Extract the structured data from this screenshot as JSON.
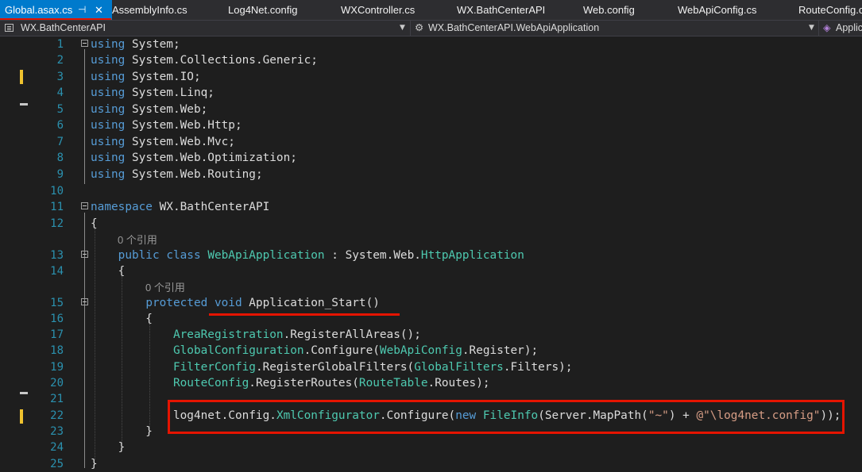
{
  "tabs": [
    {
      "label": "Global.asax.cs",
      "active": true,
      "pin_glyph": "⊣",
      "close_glyph": "✕"
    },
    {
      "label": "AssemblyInfo.cs"
    },
    {
      "label": "Log4Net.config"
    },
    {
      "label": "WXController.cs"
    },
    {
      "label": "WX.BathCenterAPI"
    },
    {
      "label": "Web.config"
    },
    {
      "label": "WebApiConfig.cs"
    },
    {
      "label": "RouteConfig.c"
    }
  ],
  "navbar": {
    "project": "WX.BathCenterAPI",
    "type_scope": "WX.BathCenterAPI.WebApiApplication",
    "member_scope": "Applic"
  },
  "codelens": {
    "class_refs": "0 个引用",
    "method_refs": "0 个引用"
  },
  "lines": [
    {
      "n": "1",
      "tokens": [
        {
          "t": "using",
          "c": "kw"
        },
        {
          "t": " System;",
          "c": "pl"
        }
      ]
    },
    {
      "n": "2",
      "tokens": [
        {
          "t": "using",
          "c": "kw"
        },
        {
          "t": " System.Collections.Generic;",
          "c": "pl"
        }
      ]
    },
    {
      "n": "3",
      "tokens": [
        {
          "t": "using",
          "c": "kw"
        },
        {
          "t": " System.IO;",
          "c": "pl"
        }
      ]
    },
    {
      "n": "4",
      "tokens": [
        {
          "t": "using",
          "c": "kw"
        },
        {
          "t": " System.Linq;",
          "c": "pl"
        }
      ]
    },
    {
      "n": "5",
      "tokens": [
        {
          "t": "using",
          "c": "kw"
        },
        {
          "t": " System.Web;",
          "c": "pl"
        }
      ]
    },
    {
      "n": "6",
      "tokens": [
        {
          "t": "using",
          "c": "kw"
        },
        {
          "t": " System.Web.Http;",
          "c": "pl"
        }
      ]
    },
    {
      "n": "7",
      "tokens": [
        {
          "t": "using",
          "c": "kw"
        },
        {
          "t": " System.Web.Mvc;",
          "c": "pl"
        }
      ]
    },
    {
      "n": "8",
      "tokens": [
        {
          "t": "using",
          "c": "kw"
        },
        {
          "t": " System.Web.Optimization;",
          "c": "pl"
        }
      ]
    },
    {
      "n": "9",
      "tokens": [
        {
          "t": "using",
          "c": "kw"
        },
        {
          "t": " System.Web.Routing;",
          "c": "pl"
        }
      ]
    },
    {
      "n": "10",
      "tokens": []
    },
    {
      "n": "11",
      "tokens": [
        {
          "t": "namespace",
          "c": "kw"
        },
        {
          "t": " WX.BathCenterAPI",
          "c": "pl"
        }
      ]
    },
    {
      "n": "12",
      "tokens": [
        {
          "t": "{",
          "c": "pl"
        }
      ]
    },
    {
      "n": "13",
      "tokens": [
        {
          "t": "    ",
          "c": "pl"
        },
        {
          "t": "public",
          "c": "kw"
        },
        {
          "t": " ",
          "c": "pl"
        },
        {
          "t": "class",
          "c": "kw"
        },
        {
          "t": " ",
          "c": "pl"
        },
        {
          "t": "WebApiApplication",
          "c": "ty"
        },
        {
          "t": " : System.Web.",
          "c": "pl"
        },
        {
          "t": "HttpApplication",
          "c": "ty"
        }
      ]
    },
    {
      "n": "14",
      "tokens": [
        {
          "t": "    {",
          "c": "pl"
        }
      ]
    },
    {
      "n": "15",
      "tokens": [
        {
          "t": "        ",
          "c": "pl"
        },
        {
          "t": "protected",
          "c": "kw"
        },
        {
          "t": " ",
          "c": "pl"
        },
        {
          "t": "void",
          "c": "kw"
        },
        {
          "t": " Application_Start()",
          "c": "pl"
        }
      ]
    },
    {
      "n": "16",
      "tokens": [
        {
          "t": "        {",
          "c": "pl"
        }
      ]
    },
    {
      "n": "17",
      "tokens": [
        {
          "t": "            ",
          "c": "pl"
        },
        {
          "t": "AreaRegistration",
          "c": "ty"
        },
        {
          "t": ".RegisterAllAreas();",
          "c": "pl"
        }
      ]
    },
    {
      "n": "18",
      "tokens": [
        {
          "t": "            ",
          "c": "pl"
        },
        {
          "t": "GlobalConfiguration",
          "c": "ty"
        },
        {
          "t": ".Configure(",
          "c": "pl"
        },
        {
          "t": "WebApiConfig",
          "c": "ty"
        },
        {
          "t": ".Register);",
          "c": "pl"
        }
      ]
    },
    {
      "n": "19",
      "tokens": [
        {
          "t": "            ",
          "c": "pl"
        },
        {
          "t": "FilterConfig",
          "c": "ty"
        },
        {
          "t": ".RegisterGlobalFilters(",
          "c": "pl"
        },
        {
          "t": "GlobalFilters",
          "c": "ty"
        },
        {
          "t": ".Filters);",
          "c": "pl"
        }
      ]
    },
    {
      "n": "20",
      "tokens": [
        {
          "t": "            ",
          "c": "pl"
        },
        {
          "t": "RouteConfig",
          "c": "ty"
        },
        {
          "t": ".RegisterRoutes(",
          "c": "pl"
        },
        {
          "t": "RouteTable",
          "c": "ty"
        },
        {
          "t": ".Routes);",
          "c": "pl"
        }
      ]
    },
    {
      "n": "21",
      "tokens": []
    },
    {
      "n": "22",
      "tokens": [
        {
          "t": "            log4net.Config.",
          "c": "pl"
        },
        {
          "t": "XmlConfigurator",
          "c": "ty"
        },
        {
          "t": ".Configure(",
          "c": "pl"
        },
        {
          "t": "new",
          "c": "kw"
        },
        {
          "t": " ",
          "c": "pl"
        },
        {
          "t": "FileInfo",
          "c": "ty"
        },
        {
          "t": "(Server.MapPath(",
          "c": "pl"
        },
        {
          "t": "\"~\"",
          "c": "st"
        },
        {
          "t": ") + ",
          "c": "pl"
        },
        {
          "t": "@\"\\log4net.config\"",
          "c": "st"
        },
        {
          "t": "));",
          "c": "pl"
        }
      ]
    },
    {
      "n": "23",
      "tokens": [
        {
          "t": "        }",
          "c": "pl"
        }
      ]
    },
    {
      "n": "24",
      "tokens": [
        {
          "t": "    }",
          "c": "pl"
        }
      ]
    },
    {
      "n": "25",
      "tokens": [
        {
          "t": "}",
          "c": "pl"
        }
      ]
    }
  ],
  "colors": {
    "keyword": "#569cd6",
    "type": "#4ec9b0",
    "string": "#d69d85",
    "line_number": "#2b91af",
    "active_tab": "#007acc",
    "highlight_annotation": "#e51400"
  }
}
